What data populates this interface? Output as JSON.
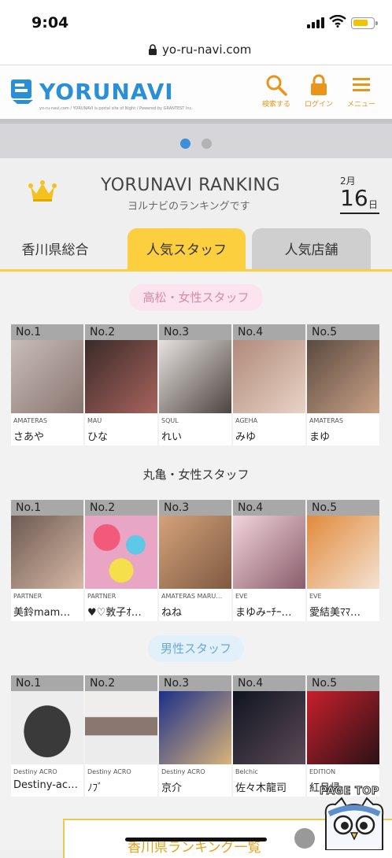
{
  "statusbar": {
    "time": "9:04"
  },
  "browser": {
    "url": "yo-ru-navi.com"
  },
  "header": {
    "logo_text": "YORUNAVI",
    "logo_sub": "yo-ru-navi.com / YORUNAVI is portal site of Night / Powered by GRANTEST Inc.",
    "search_label": "検索する",
    "login_label": "ログイン",
    "menu_label": "メニュー"
  },
  "ranking": {
    "title": "YORUNAVI RANKING",
    "subtitle": "ヨルナビのランキングです",
    "date_month": "2月",
    "date_day": "16",
    "date_unit": "日"
  },
  "tabs": [
    {
      "label": "香川県総合"
    },
    {
      "label": "人気スタッフ"
    },
    {
      "label": "人気店舗"
    }
  ],
  "sections": [
    {
      "title": "高松・女性スタッフ",
      "cards": [
        {
          "rank": "No.1",
          "shop": "AMATERAS",
          "name": "さあや"
        },
        {
          "rank": "No.2",
          "shop": "MAU",
          "name": "ひな"
        },
        {
          "rank": "No.3",
          "shop": "SQUL",
          "name": "れい"
        },
        {
          "rank": "No.4",
          "shop": "AGEHA",
          "name": "みゆ"
        },
        {
          "rank": "No.5",
          "shop": "AMATERAS",
          "name": "まゆ"
        }
      ]
    },
    {
      "title": "丸亀・女性スタッフ",
      "cards": [
        {
          "rank": "No.1",
          "shop": "PARTNER",
          "name": "美鈴mam…"
        },
        {
          "rank": "No.2",
          "shop": "PARTNER",
          "name": "♥♡敦子ｵ…"
        },
        {
          "rank": "No.3",
          "shop": "AMATERAS MARU…",
          "name": "ねね"
        },
        {
          "rank": "No.4",
          "shop": "EVE",
          "name": "まゆみｰﾁｰ…"
        },
        {
          "rank": "No.5",
          "shop": "EVE",
          "name": "愛結美ﾏﾏ…"
        }
      ]
    },
    {
      "title": "男性スタッフ",
      "cards": [
        {
          "rank": "No.1",
          "shop": "Destiny ACRO",
          "name": "Destiny-ac…"
        },
        {
          "rank": "No.2",
          "shop": "Destiny ACRO",
          "name": "ﾉﾌﾞ"
        },
        {
          "rank": "No.3",
          "shop": "Destiny ACRO",
          "name": "京介"
        },
        {
          "rank": "No.4",
          "shop": "Belchic",
          "name": "佐々木龍司"
        },
        {
          "rank": "No.5",
          "shop": "EDITION",
          "name": "紅月帰"
        }
      ]
    }
  ],
  "bottom": {
    "label": "香川県ランキング一覧"
  },
  "pagetop": {
    "label": "PAGE TOP"
  },
  "colors": {
    "accent": "#fbcf3d",
    "brand": "#2b8fd6",
    "tab_gray": "#cfcfcf",
    "orange": "#e8951a"
  }
}
